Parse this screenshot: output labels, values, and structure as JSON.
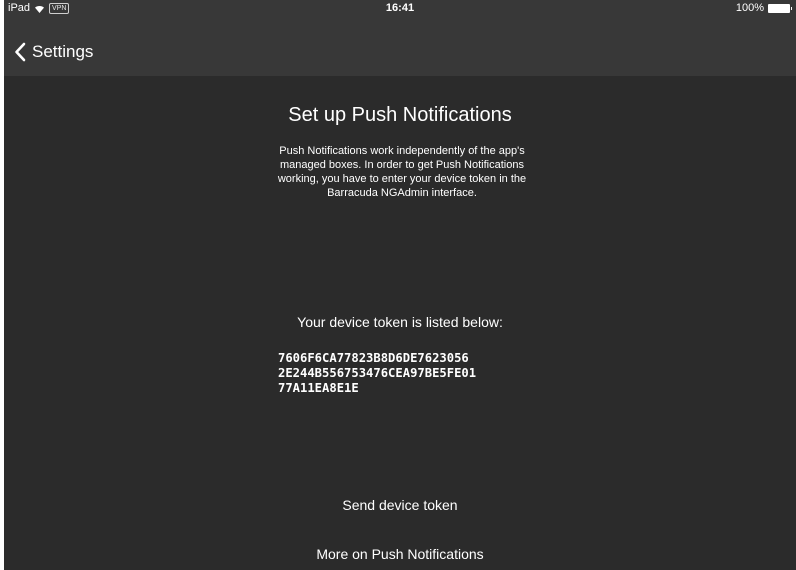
{
  "status_bar": {
    "device": "iPad",
    "vpn": "VPN",
    "time": "16:41",
    "battery": "100%"
  },
  "nav": {
    "back_label": "Settings"
  },
  "main": {
    "title": "Set up Push Notifications",
    "description": "Push Notifications work independently of the app's managed boxes. In order to get Push Notifications working, you have to enter your device token in the Barracuda NGAdmin interface.",
    "token_label": "Your device token is listed below:",
    "token_lines": [
      "7606F6CA77823B8D6DE7623056",
      "2E244B556753476CEA97BE5FE01",
      "77A11EA8E1E"
    ],
    "send_token_label": "Send device token",
    "more_info_label": "More on Push Notifications"
  },
  "colors": {
    "background": "#2b2b2b",
    "bar": "#383838",
    "text": "#ffffff"
  }
}
